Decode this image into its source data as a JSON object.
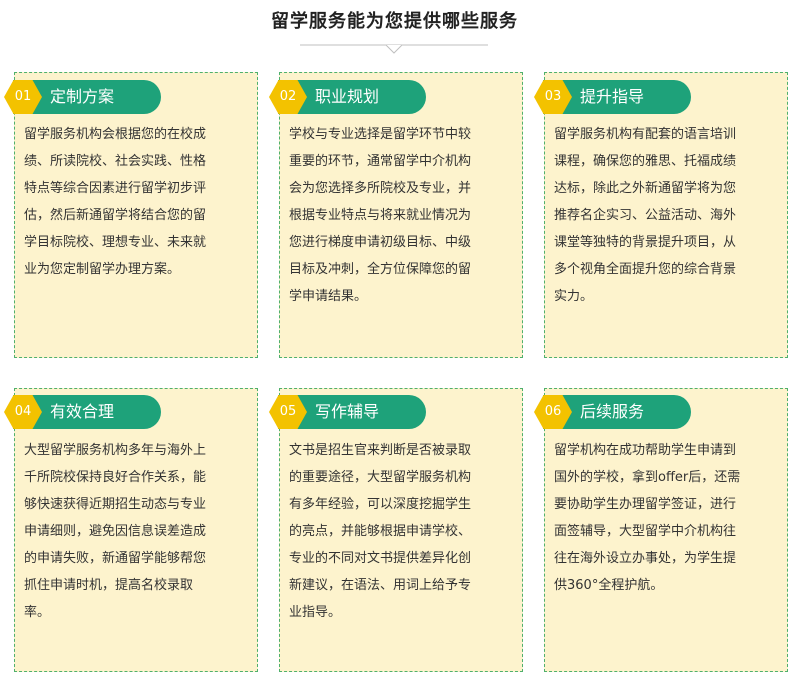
{
  "page": {
    "title": "留学服务能为您提供哪些服务"
  },
  "colors": {
    "card_bg": "#fdf3cd",
    "card_border": "#4fb06c",
    "badge_green": "#1ea27a",
    "badge_yellow": "#f3c200"
  },
  "cards": [
    {
      "number": "01",
      "title": "定制方案",
      "lines": [
        "留学服务机构会根据您的在校成",
        "绩、所读院校、社会实践、性格",
        "特点等综合因素进行留学初步评",
        "估，然后新通留学将结合您的留",
        "学目标院校、理想专业、未来就",
        "业为您定制留学办理方案。"
      ]
    },
    {
      "number": "02",
      "title": "职业规划",
      "lines": [
        "学校与专业选择是留学环节中较",
        "重要的环节，通常留学中介机构",
        "会为您选择多所院校及专业，并",
        "根据专业特点与将来就业情况为",
        "您进行梯度申请初级目标、中级",
        "目标及冲刺，全方位保障您的留",
        "学申请结果。"
      ]
    },
    {
      "number": "03",
      "title": "提升指导",
      "lines": [
        "留学服务机构有配套的语言培训",
        "课程，确保您的雅思、托福成绩",
        "达标，除此之外新通留学将为您",
        "推荐名企实习、公益活动、海外",
        "课堂等独特的背景提升项目，从",
        "多个视角全面提升您的综合背景",
        "实力。"
      ]
    },
    {
      "number": "04",
      "title": "有效合理",
      "lines": [
        "大型留学服务机构多年与海外上",
        "千所院校保持良好合作关系，能",
        "够快速获得近期招生动态与专业",
        "申请细则，避免因信息误差造成",
        "的申请失败，新通留学能够帮您",
        "抓住申请时机，提高名校录取",
        "率。"
      ]
    },
    {
      "number": "05",
      "title": "写作辅导",
      "lines": [
        "文书是招生官来判断是否被录取",
        "的重要途径，大型留学服务机构",
        "有多年经验，可以深度挖掘学生",
        "的亮点，并能够根据申请学校、",
        "专业的不同对文书提供差异化创",
        "新建议，在语法、用词上给予专",
        "业指导。"
      ]
    },
    {
      "number": "06",
      "title": "后续服务",
      "lines": [
        "留学机构在成功帮助学生申请到",
        "国外的学校，拿到offer后，还需",
        "要协助学生办理留学签证，进行",
        "面签辅导，大型留学中介机构往",
        "往在海外设立办事处，为学生提",
        "供360°全程护航。"
      ]
    }
  ]
}
